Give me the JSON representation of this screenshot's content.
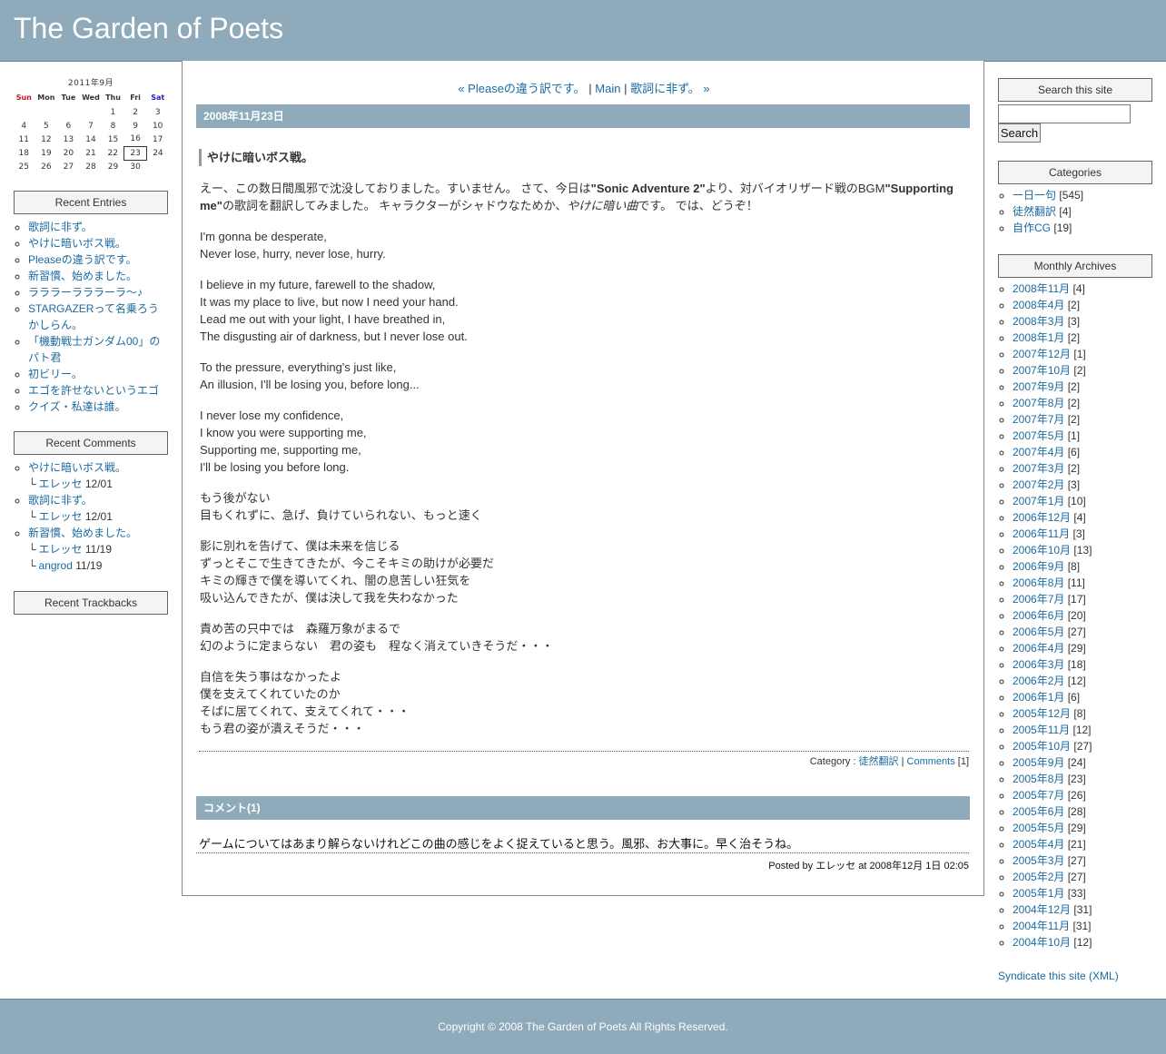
{
  "site": {
    "title": "The Garden of Poets"
  },
  "calendar": {
    "caption": "2011年9月",
    "weekdays": [
      "Sun",
      "Mon",
      "Tue",
      "Wed",
      "Thu",
      "Fri",
      "Sat"
    ],
    "weeks": [
      [
        "",
        "",
        "",
        "",
        "1",
        "2",
        "3"
      ],
      [
        "4",
        "5",
        "6",
        "7",
        "8",
        "9",
        "10"
      ],
      [
        "11",
        "12",
        "13",
        "14",
        "15",
        "16",
        "17"
      ],
      [
        "18",
        "19",
        "20",
        "21",
        "22",
        "23",
        "24"
      ],
      [
        "25",
        "26",
        "27",
        "28",
        "29",
        "30",
        ""
      ]
    ],
    "today": "23"
  },
  "recent_entries": {
    "heading": "Recent Entries",
    "items": [
      "歌詞に非ず。",
      "やけに暗いボス戦。",
      "Pleaseの違う訳です。",
      "新習慣、始めました。",
      "ラララーラララーラ～♪",
      "STARGAZERって名乗ろうかしらん。",
      "「機動戦士ガンダム00」のパト君",
      "初ビリー。",
      "エゴを許せないというエゴ",
      "クイズ・私達は誰。"
    ]
  },
  "recent_comments": {
    "heading": "Recent Comments",
    "groups": [
      {
        "entry": "やけに暗いボス戦。",
        "comments": [
          {
            "author": "エレッセ",
            "date": "12/01"
          }
        ]
      },
      {
        "entry": "歌詞に非ず。",
        "comments": [
          {
            "author": "エレッセ",
            "date": "12/01"
          }
        ]
      },
      {
        "entry": "新習慣、始めました。",
        "comments": [
          {
            "author": "エレッセ",
            "date": "11/19"
          },
          {
            "author": "angrod",
            "date": "11/19"
          }
        ]
      }
    ],
    "bracket": "└"
  },
  "recent_trackbacks": {
    "heading": "Recent Trackbacks"
  },
  "nav": {
    "prev": "« Pleaseの違う訳です。",
    "separator": "|",
    "main": "Main",
    "next": "歌詞に非ず。 »"
  },
  "entry": {
    "date": "2008年11月23日",
    "title": "やけに暗いボス戦。",
    "intro": {
      "part1": "えー、この数日間風邪で沈没しておりました。すいません。 さて、今日は",
      "bold1": "\"Sonic Adventure 2\"",
      "part2": "より、対バイオリザード戦のBGM",
      "bold2": "\"Supporting me\"",
      "part3": "の歌詞を翻訳してみました。 キャラクターがシャドウなためか、",
      "italic": "やけに暗い曲",
      "part4": "です。 では、どうぞ！"
    },
    "stanzas": [
      [
        "I'm gonna be desperate,",
        "Never lose, hurry, never lose, hurry."
      ],
      [
        "I believe in my future, farewell to the shadow,",
        "It was my place to live, but now I need your hand.",
        "Lead me out with your light, I have breathed in,",
        "The disgusting air of darkness, but I never lose out."
      ],
      [
        "To the pressure, everything's just like,",
        "An illusion, I'll be losing you, before long..."
      ],
      [
        "I never lose my confidence,",
        "I know you were supporting me,",
        "Supporting me, supporting me,",
        "I'll be losing you before long."
      ],
      [
        "もう後がない",
        "目もくれずに、急げ、負けていられない、もっと速く"
      ],
      [
        "影に別れを告げて、僕は未来を信じる",
        "ずっとそこで生きてきたが、今こそキミの助けが必要だ",
        "キミの輝きで僕を導いてくれ、闇の息苦しい狂気を",
        "吸い込んできたが、僕は決して我を失わなかった"
      ],
      [
        "責め苦の只中では　森羅万象がまるで",
        "幻のように定まらない　君の姿も　程なく消えていきそうだ・・・"
      ],
      [
        "自信を失う事はなかったよ",
        "僕を支えてくれていたのか",
        "そばに居てくれて、支えてくれて・・・",
        "もう君の姿が潰えそうだ・・・"
      ]
    ],
    "footer": {
      "category_label": "Category :",
      "category": "徒然翻訳",
      "separator": "|",
      "comments_link": "Comments",
      "comments_count": "[1]"
    }
  },
  "comments_section": {
    "heading": "コメント(1)",
    "comment": {
      "text": "ゲームについてはあまり解らないけれどこの曲の感じをよく捉えていると思う。風邪、お大事に。早く治そうね。",
      "posted_by_label": "Posted by",
      "author": "エレッセ",
      "at_label": "at",
      "datetime": "2008年12月 1日 02:05"
    }
  },
  "search": {
    "heading": "Search this site",
    "value": "",
    "button": "Search"
  },
  "categories": {
    "heading": "Categories",
    "items": [
      {
        "name": "一日一句",
        "count": "[545]"
      },
      {
        "name": "徒然翻訳",
        "count": "[4]"
      },
      {
        "name": "自作CG",
        "count": "[19]"
      }
    ]
  },
  "archives": {
    "heading": "Monthly Archives",
    "items": [
      {
        "name": "2008年11月",
        "count": "[4]"
      },
      {
        "name": "2008年4月",
        "count": "[2]"
      },
      {
        "name": "2008年3月",
        "count": "[3]"
      },
      {
        "name": "2008年1月",
        "count": "[2]"
      },
      {
        "name": "2007年12月",
        "count": "[1]"
      },
      {
        "name": "2007年10月",
        "count": "[2]"
      },
      {
        "name": "2007年9月",
        "count": "[2]"
      },
      {
        "name": "2007年8月",
        "count": "[2]"
      },
      {
        "name": "2007年7月",
        "count": "[2]"
      },
      {
        "name": "2007年5月",
        "count": "[1]"
      },
      {
        "name": "2007年4月",
        "count": "[6]"
      },
      {
        "name": "2007年3月",
        "count": "[2]"
      },
      {
        "name": "2007年2月",
        "count": "[3]"
      },
      {
        "name": "2007年1月",
        "count": "[10]"
      },
      {
        "name": "2006年12月",
        "count": "[4]"
      },
      {
        "name": "2006年11月",
        "count": "[3]"
      },
      {
        "name": "2006年10月",
        "count": "[13]"
      },
      {
        "name": "2006年9月",
        "count": "[8]"
      },
      {
        "name": "2006年8月",
        "count": "[11]"
      },
      {
        "name": "2006年7月",
        "count": "[17]"
      },
      {
        "name": "2006年6月",
        "count": "[20]"
      },
      {
        "name": "2006年5月",
        "count": "[27]"
      },
      {
        "name": "2006年4月",
        "count": "[29]"
      },
      {
        "name": "2006年3月",
        "count": "[18]"
      },
      {
        "name": "2006年2月",
        "count": "[12]"
      },
      {
        "name": "2006年1月",
        "count": "[6]"
      },
      {
        "name": "2005年12月",
        "count": "[8]"
      },
      {
        "name": "2005年11月",
        "count": "[12]"
      },
      {
        "name": "2005年10月",
        "count": "[27]"
      },
      {
        "name": "2005年9月",
        "count": "[24]"
      },
      {
        "name": "2005年8月",
        "count": "[23]"
      },
      {
        "name": "2005年7月",
        "count": "[26]"
      },
      {
        "name": "2005年6月",
        "count": "[28]"
      },
      {
        "name": "2005年5月",
        "count": "[29]"
      },
      {
        "name": "2005年4月",
        "count": "[21]"
      },
      {
        "name": "2005年3月",
        "count": "[27]"
      },
      {
        "name": "2005年2月",
        "count": "[27]"
      },
      {
        "name": "2005年1月",
        "count": "[33]"
      },
      {
        "name": "2004年12月",
        "count": "[31]"
      },
      {
        "name": "2004年11月",
        "count": "[31]"
      },
      {
        "name": "2004年10月",
        "count": "[12]"
      }
    ]
  },
  "syndicate": "Syndicate this site (XML)",
  "footer": {
    "copyright": "Copyright © 2008 The Garden of Poets All Rights Reserved."
  },
  "colors": {
    "banner": "#8faabb",
    "link": "#1a6aa0",
    "sunday": "#c0161c",
    "saturday": "#1f1fb5"
  }
}
